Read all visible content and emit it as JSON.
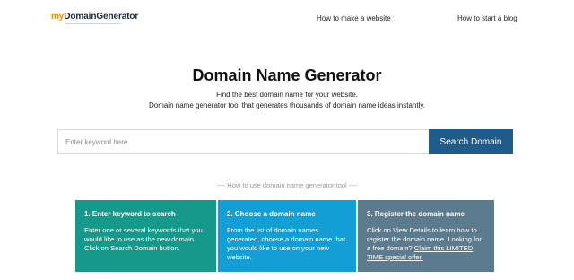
{
  "header": {
    "logo": {
      "prefix": "my",
      "brand": "DomainGenerator"
    },
    "nav": [
      {
        "label": "How to make a website"
      },
      {
        "label": "How to start a blog"
      }
    ]
  },
  "hero": {
    "title": "Domain Name Generator",
    "subtitle_line1": "Find the best domain name for your website.",
    "subtitle_line2": "Domain name generator tool that generates thousands of domain name ideas instantly."
  },
  "search": {
    "placeholder": "Enter keyword here",
    "value": "",
    "button_label": "Search Domain"
  },
  "howto": {
    "label": "---- How to use domain name generator tool ----"
  },
  "steps": [
    {
      "title": "1. Enter keyword to search",
      "text": "Enter one or several keywords that you would like to use as the new domain. Click on Search Domain button."
    },
    {
      "title": "2. Choose a domain name",
      "text": "From the list of domain names generated, choose a domain name that you would like to use on your new website."
    },
    {
      "title": "3. Register the domain name",
      "text": "Click on View Details to learn how to register the domain name. Looking for a free domain?",
      "link": "Claim this LIMITED TIME special offer."
    }
  ],
  "colors": {
    "logo_accent": "#f28c00",
    "logo_brand": "#1d2a3a",
    "search_button": "#1f5b8b",
    "step1_bg": "#16998a",
    "step2_bg": "#139ed6",
    "step3_bg": "#5d7b8f"
  }
}
